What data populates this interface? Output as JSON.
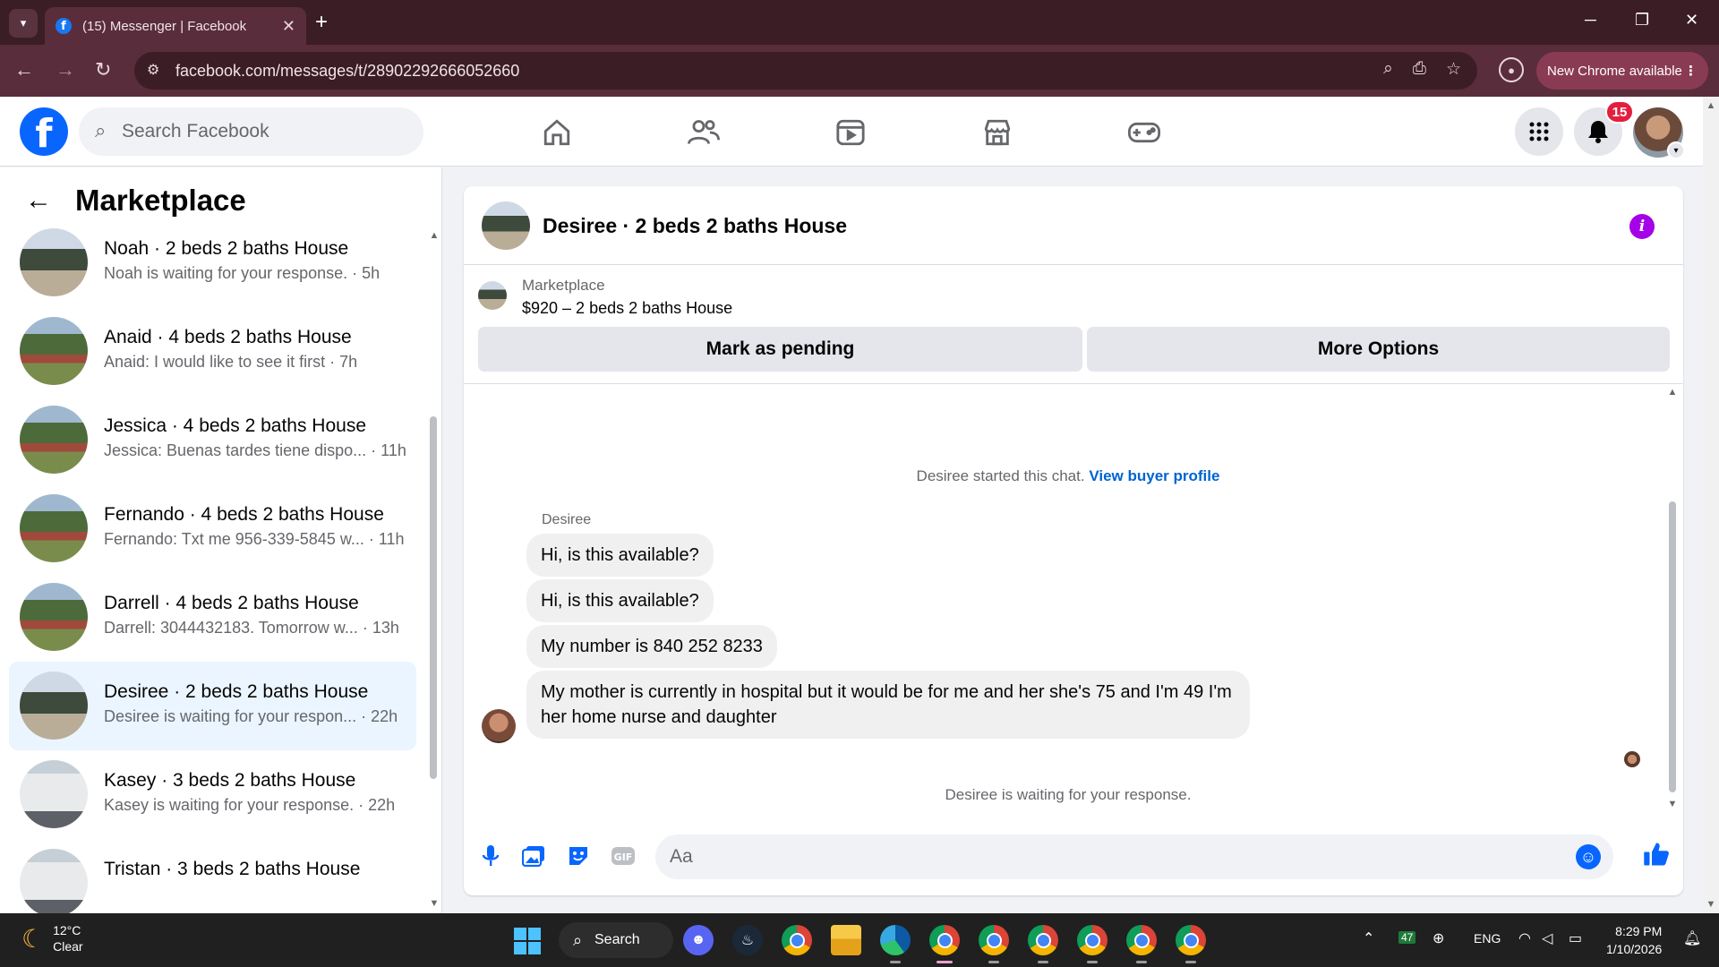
{
  "browser": {
    "tab_title": "(15) Messenger | Facebook",
    "url": "facebook.com/messages/t/28902292666052660",
    "new_chrome_label": "New Chrome available"
  },
  "fb": {
    "search_placeholder": "Search Facebook",
    "notification_count": "15"
  },
  "sidebar": {
    "title": "Marketplace",
    "conversations": [
      {
        "title": "Noah · 2 beds 2 baths House",
        "preview": "Noah is waiting for your response. · 5h",
        "thumb": "house"
      },
      {
        "title": "Anaid · 4 beds 2 baths House",
        "preview": "Anaid: I would like to see it first · 7h",
        "thumb": "tree"
      },
      {
        "title": "Jessica · 4 beds 2 baths House",
        "preview": "Jessica: Buenas tardes tiene dispo...  · 11h",
        "thumb": "tree"
      },
      {
        "title": "Fernando · 4 beds 2 baths House",
        "preview": "Fernando: Txt me 956-339-5845 w...  · 11h",
        "thumb": "tree"
      },
      {
        "title": "Darrell · 4 beds 2 baths House",
        "preview": "Darrell: 3044432183. Tomorrow w...  · 13h",
        "thumb": "tree"
      },
      {
        "title": "Desiree · 2 beds 2 baths House",
        "preview": "Desiree is waiting for your respon...  · 22h",
        "thumb": "house",
        "active": true
      },
      {
        "title": "Kasey · 3 beds 2 baths House",
        "preview": "Kasey is waiting for your response. · 22h",
        "thumb": "white"
      },
      {
        "title": "Tristan · 3 beds 2 baths House",
        "preview": "",
        "thumb": "white"
      }
    ]
  },
  "chat": {
    "title": "Desiree · 2 beds 2 baths House",
    "listing_source": "Marketplace",
    "listing_price": "$920 – 2 beds 2 baths House",
    "mark_pending_label": "Mark as pending",
    "more_options_label": "More Options",
    "started_text": "Desiree started this chat.",
    "view_profile_label": "View buyer profile",
    "sender_name": "Desiree",
    "messages": [
      "Hi, is this available?",
      "Hi, is this available?",
      "My number is 840 252 8233",
      "My mother is currently in hospital but it would be for me and her she's 75 and I'm 49 I'm her home nurse and daughter"
    ],
    "waiting_text": "Desiree is waiting for your response.",
    "composer_placeholder": "Aa"
  },
  "taskbar": {
    "temperature": "12°C",
    "weather": "Clear",
    "search_label": "Search",
    "tray_badge": "47",
    "language": "ENG",
    "time": "8:29 PM",
    "date": "1/10/2026"
  },
  "colors": {
    "fb_blue": "#0866ff",
    "chrome_frame": "#3b1d26",
    "active_conv": "#ebf5ff",
    "badge_red": "#e41e3f"
  }
}
